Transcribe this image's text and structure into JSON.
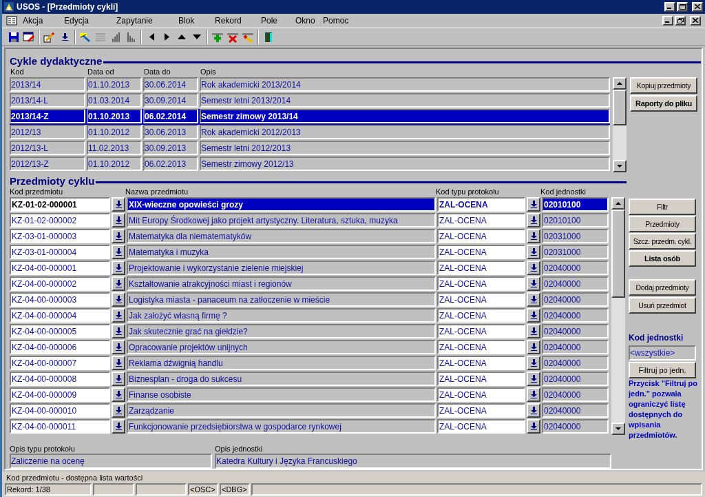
{
  "window": {
    "title": "USOS - [Przedmioty cykli]"
  },
  "menu": [
    {
      "label": "Akcja"
    },
    {
      "label": "Edycja"
    },
    {
      "label": "Zapytanie"
    },
    {
      "label": "Blok"
    },
    {
      "label": "Rekord"
    },
    {
      "label": "Pole"
    },
    {
      "label": "Okno"
    },
    {
      "label": "Pomoc"
    }
  ],
  "cycles": {
    "title": "Cykle dydaktyczne",
    "columns": [
      "Kod",
      "Data od",
      "Data do",
      "Opis"
    ],
    "rows": [
      {
        "cells": [
          "2013/14",
          "01.10.2013",
          "30.06.2014",
          "Rok akademicki 2013/2014"
        ],
        "selected": false
      },
      {
        "cells": [
          "2013/14-L",
          "01.03.2014",
          "30.09.2014",
          "Semestr letni 2013/2014"
        ],
        "selected": false
      },
      {
        "cells": [
          "2013/14-Z",
          "01.10.2013",
          "06.02.2014",
          "Semestr zimowy 2013/14"
        ],
        "selected": true
      },
      {
        "cells": [
          "2012/13",
          "01.10.2012",
          "30.06.2013",
          "Rok akademicki 2012/2013"
        ],
        "selected": false
      },
      {
        "cells": [
          "2012/13-L",
          "11.02.2013",
          "30.09.2013",
          "Semestr letni 2012/2013"
        ],
        "selected": false
      },
      {
        "cells": [
          "2012/13-Z",
          "01.10.2012",
          "06.02.2013",
          "Semestr zimowy 2012/13"
        ],
        "selected": false
      }
    ],
    "buttons": [
      {
        "label": "Kopiuj przedmioty",
        "kind": "normal"
      },
      {
        "label": "Raporty do pliku",
        "kind": "default"
      }
    ]
  },
  "subjects": {
    "title": "Przedmioty cyklu",
    "columns": [
      "Kod przedmiotu",
      "Nazwa przedmiotu",
      "Kod typu protokołu",
      "Kod jednostki"
    ],
    "rows": [
      {
        "code": "KZ-01-02-000001",
        "name": "XIX-wieczne opowieści grozy",
        "type": "ZAL-OCENA",
        "unit": "02010100",
        "selected": true
      },
      {
        "code": "KZ-01-02-000002",
        "name": "Mit Europy Środkowej jako projekt artystyczny. Literatura, sztuka, muzyka",
        "type": "ZAL-OCENA",
        "unit": "02010100",
        "selected": false
      },
      {
        "code": "KZ-03-01-000003",
        "name": "Matematyka dla niematematyków",
        "type": "ZAL-OCENA",
        "unit": "02031000",
        "selected": false
      },
      {
        "code": "KZ-03-01-000004",
        "name": "Matematyka i muzyka",
        "type": "ZAL-OCENA",
        "unit": "02031000",
        "selected": false
      },
      {
        "code": "KZ-04-00-000001",
        "name": "Projektowanie i wykorzystanie zielenie miejskiej",
        "type": "ZAL-OCENA",
        "unit": "02040000",
        "selected": false
      },
      {
        "code": "KZ-04-00-000002",
        "name": "Kształtowanie atrakcyjności miast i regionów",
        "type": "ZAL-OCENA",
        "unit": "02040000",
        "selected": false
      },
      {
        "code": "KZ-04-00-000003",
        "name": "Logistyka miasta - panaceum na zatłoczenie w mieście",
        "type": "ZAL-OCENA",
        "unit": "02040000",
        "selected": false
      },
      {
        "code": "KZ-04-00-000004",
        "name": "Jak założyć własną firmę ?",
        "type": "ZAL-OCENA",
        "unit": "02040000",
        "selected": false
      },
      {
        "code": "KZ-04-00-000005",
        "name": "Jak skutecznie grać na giełdzie?",
        "type": "ZAL-OCENA",
        "unit": "02040000",
        "selected": false
      },
      {
        "code": "KZ-04-00-000006",
        "name": "Opracowanie projektów unijnych",
        "type": "ZAL-OCENA",
        "unit": "02040000",
        "selected": false
      },
      {
        "code": "KZ-04-00-000007",
        "name": "Reklama dźwignią handlu",
        "type": "ZAL-OCENA",
        "unit": "02040000",
        "selected": false
      },
      {
        "code": "KZ-04-00-000008",
        "name": "Biznesplan - droga do sukcesu",
        "type": "ZAL-OCENA",
        "unit": "02040000",
        "selected": false
      },
      {
        "code": "KZ-04-00-000009",
        "name": "Finanse osobiste",
        "type": "ZAL-OCENA",
        "unit": "02040000",
        "selected": false
      },
      {
        "code": "KZ-04-00-000010",
        "name": "Zarządzanie",
        "type": "ZAL-OCENA",
        "unit": "02040000",
        "selected": false
      },
      {
        "code": "KZ-04-00-000011",
        "name": "Funkcjonowanie przedsiębiorstwa w gospodarce rynkowej",
        "type": "ZAL-OCENA",
        "unit": "02040000",
        "selected": false
      }
    ],
    "buttons": [
      {
        "label": "Filtr",
        "kind": "normal"
      },
      {
        "label": "Przedmioty",
        "kind": "normal"
      },
      {
        "label": "Szcz. przedm. cykl.",
        "kind": "normal"
      },
      {
        "label": "Lista osób",
        "kind": "default"
      },
      {
        "label": "Dodaj przedmioty",
        "kind": "normal"
      },
      {
        "label": "Usuń przedmiot",
        "kind": "normal"
      }
    ],
    "unit_filter": {
      "label": "Kod jednostki",
      "value": "<wszystkie>",
      "button": "Filtruj po jedn.",
      "hint": "Przycisk \"Filtruj po jedn.\" pozwala ograniczyć listę dostępnych do wpisania przedmiotów."
    }
  },
  "details": [
    {
      "label": "Opis typu protokołu",
      "value": "Zaliczenie na ocenę"
    },
    {
      "label": "Opis jednostki",
      "value": "Katedra Kultury i Języka Francuskiego"
    }
  ],
  "status_bar": {
    "message": "Kod przedmiotu - dostępna lista wartości",
    "fields": [
      "Rekord: 1/38",
      "<OSC>",
      "<DBG>"
    ]
  }
}
